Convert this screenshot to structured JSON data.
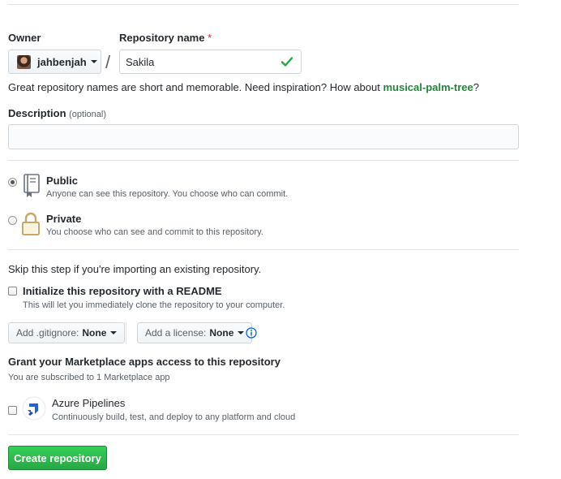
{
  "owner": {
    "label": "Owner",
    "value": "jahbenjah"
  },
  "separator": "/",
  "repo_name": {
    "label": "Repository name",
    "required_mark": "*",
    "value": "Sakila"
  },
  "hint": {
    "text": "Great repository names are short and memorable. Need inspiration? How about ",
    "suggestion": "musical-palm-tree",
    "end": "?"
  },
  "description": {
    "label": "Description",
    "optional": "(optional)",
    "value": ""
  },
  "visibility": [
    {
      "title": "Public",
      "note": "Anyone can see this repository. You choose who can commit.",
      "selected": true
    },
    {
      "title": "Private",
      "note": "You choose who can see and commit to this repository.",
      "selected": false
    }
  ],
  "import_note": "Skip this step if you're importing an existing repository.",
  "readme": {
    "label": "Initialize this repository with a README",
    "note": "This will let you immediately clone the repository to your computer.",
    "checked": false
  },
  "gitignore": {
    "label": "Add .gitignore:",
    "value": "None"
  },
  "license": {
    "label": "Add a license:",
    "value": "None"
  },
  "marketplace": {
    "title": "Grant your Marketplace apps access to this repository",
    "subtitle": "You are subscribed to 1 Marketplace app",
    "apps": [
      {
        "name": "Azure Pipelines",
        "desc": "Continuously build, test, and deploy to any platform and cloud",
        "checked": false
      }
    ]
  },
  "create_button": "Create repository",
  "colors": {
    "accent_green": "#28a745",
    "suggestion_green": "#22863a",
    "required_red": "#cb2431",
    "info_blue": "#0366d6"
  }
}
